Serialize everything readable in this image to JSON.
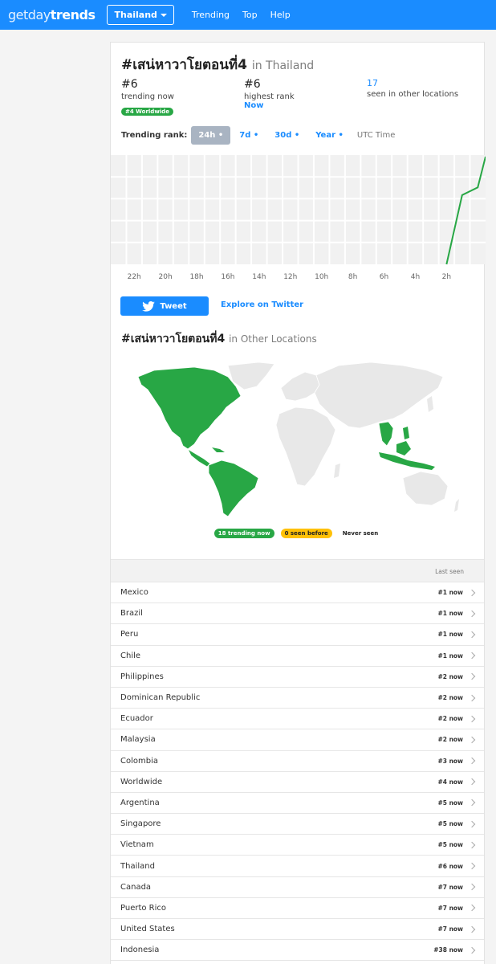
{
  "nav": {
    "logo_thin": "get",
    "logo_mid": "day",
    "logo_bold": "trends",
    "location": "Thailand",
    "links": [
      "Trending",
      "Top",
      "Help"
    ]
  },
  "topic": {
    "hashtag": "#เสน่หาวาโยตอนที่4",
    "in_location": "in Thailand",
    "in_other": "in Other Locations"
  },
  "stats": {
    "trending_rank": "#6",
    "trending_label": "trending now",
    "worldwide_badge": "#4 Worldwide",
    "highest_rank": "#6",
    "highest_label": "highest rank",
    "highest_when": "Now",
    "other_count": "17",
    "other_label": "seen in other locations"
  },
  "rank_controls": {
    "label": "Trending rank:",
    "options": [
      "24h",
      "7d",
      "30d",
      "Year"
    ],
    "active": "24h",
    "timezone": "UTC Time"
  },
  "chart_data": {
    "type": "line",
    "x_tick_labels": [
      "22h",
      "20h",
      "18h",
      "16h",
      "14h",
      "12h",
      "10h",
      "8h",
      "6h",
      "4h",
      "2h"
    ],
    "x_hours_ago": [
      23.5,
      21.5,
      19.5,
      17.5,
      15.5,
      13.5,
      11.5,
      9.5,
      7.5,
      5.5,
      3.5,
      2.5,
      1.5,
      0.5,
      0
    ],
    "rank": [
      null,
      null,
      null,
      null,
      null,
      null,
      null,
      null,
      null,
      null,
      null,
      20,
      11,
      10,
      6
    ],
    "ylim": [
      20,
      6
    ],
    "grid": true,
    "line_color": "#28a745"
  },
  "actions": {
    "tweet": "Tweet",
    "explore": "Explore on Twitter"
  },
  "legend": {
    "trending": "18 trending now",
    "seen_before": "0 seen before",
    "never": "Never seen"
  },
  "colors": {
    "brand": "#1a8cff",
    "trending": "#28a745",
    "seen": "#ffc107"
  },
  "list": {
    "header": "Last seen",
    "rows": [
      {
        "name": "Mexico",
        "rank": "#1 now"
      },
      {
        "name": "Brazil",
        "rank": "#1 now"
      },
      {
        "name": "Peru",
        "rank": "#1 now"
      },
      {
        "name": "Chile",
        "rank": "#1 now"
      },
      {
        "name": "Philippines",
        "rank": "#2 now"
      },
      {
        "name": "Dominican Republic",
        "rank": "#2 now"
      },
      {
        "name": "Ecuador",
        "rank": "#2 now"
      },
      {
        "name": "Malaysia",
        "rank": "#2 now"
      },
      {
        "name": "Colombia",
        "rank": "#3 now"
      },
      {
        "name": "Worldwide",
        "rank": "#4 now"
      },
      {
        "name": "Argentina",
        "rank": "#5 now"
      },
      {
        "name": "Singapore",
        "rank": "#5 now"
      },
      {
        "name": "Vietnam",
        "rank": "#5 now"
      },
      {
        "name": "Thailand",
        "rank": "#6 now"
      },
      {
        "name": "Canada",
        "rank": "#7 now"
      },
      {
        "name": "Puerto Rico",
        "rank": "#7 now"
      },
      {
        "name": "United States",
        "rank": "#7 now"
      },
      {
        "name": "Indonesia",
        "rank": "#38 now"
      }
    ]
  }
}
